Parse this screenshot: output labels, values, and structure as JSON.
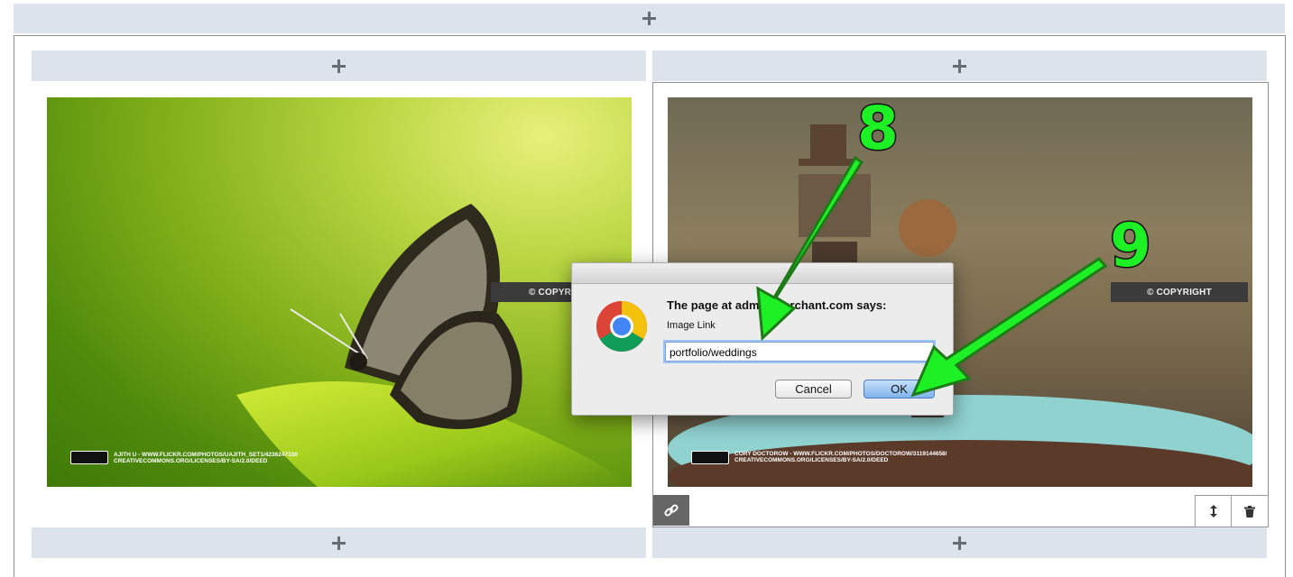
{
  "dialog": {
    "message": "The page at admin.merchant.com says:",
    "prompt_label": "Image Link",
    "input_value": "portfolio/weddings",
    "cancel_label": "Cancel",
    "ok_label": "OK",
    "icon": "chrome-icon"
  },
  "photos": {
    "left": {
      "credit_line1": "AJITH U - WWW.FLICKR.COM/PHOTOS/UAJITH_SET1/4236247330",
      "credit_line2": "CREATIVECOMMONS.ORG/LICENSES/BY-SA/2.0/DEED",
      "watermark": "© COPYRIGHT"
    },
    "right": {
      "credit_line1": "CORY DOCTOROW - WWW.FLICKR.COM/PHOTOS/DOCTOROW/3119144658/",
      "credit_line2": "CREATIVECOMMONS.ORG/LICENSES/BY-SA/2.0/DEED",
      "watermark": "© COPYRIGHT"
    }
  },
  "annotations": {
    "step_a": "8",
    "step_b": "9",
    "arrow_color": "#1ef026"
  },
  "icons": {
    "add": "plus-icon",
    "link": "link-icon",
    "resize": "vertical-arrows-icon",
    "delete": "trash-icon"
  }
}
